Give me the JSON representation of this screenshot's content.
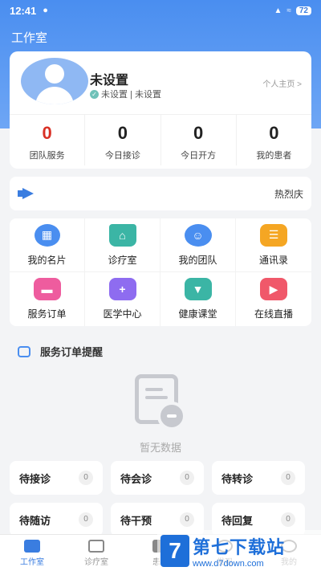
{
  "status": {
    "time": "12:41",
    "battery": "72"
  },
  "header": {
    "title": "工作室"
  },
  "profile": {
    "name": "未设置",
    "subtitle": "未设置 | 未设置",
    "home_link": "个人主页 >"
  },
  "stats": [
    {
      "value": "0",
      "label": "团队服务"
    },
    {
      "value": "0",
      "label": "今日接诊"
    },
    {
      "value": "0",
      "label": "今日开方"
    },
    {
      "value": "0",
      "label": "我的患者"
    }
  ],
  "notice": {
    "text": "热烈庆"
  },
  "menu": [
    {
      "label": "我的名片",
      "icon": "card-icon",
      "color": "#4a8ef0"
    },
    {
      "label": "诊疗室",
      "icon": "clinic-icon",
      "color": "#3bb5a5"
    },
    {
      "label": "我的团队",
      "icon": "team-icon",
      "color": "#4a8ef0"
    },
    {
      "label": "通讯录",
      "icon": "contacts-icon",
      "color": "#f5a623"
    },
    {
      "label": "服务订单",
      "icon": "order-icon",
      "color": "#ee5c9e"
    },
    {
      "label": "医学中心",
      "icon": "medical-center-icon",
      "color": "#8e6cf0"
    },
    {
      "label": "健康课堂",
      "icon": "classroom-icon",
      "color": "#3bb5a5"
    },
    {
      "label": "在线直播",
      "icon": "live-icon",
      "color": "#f0586a"
    }
  ],
  "section": {
    "title": "服务订单提醒"
  },
  "empty": {
    "text": "暂无数据"
  },
  "tasks": [
    {
      "label": "待接诊",
      "count": "0"
    },
    {
      "label": "待会诊",
      "count": "0"
    },
    {
      "label": "待转诊",
      "count": "0"
    },
    {
      "label": "待随访",
      "count": "0"
    },
    {
      "label": "待干预",
      "count": "0"
    },
    {
      "label": "待回复",
      "count": "0"
    }
  ],
  "tabbar": [
    {
      "label": "工作室",
      "icon": "studio-icon"
    },
    {
      "label": "诊疗室",
      "icon": "clinic-icon"
    },
    {
      "label": "患者",
      "icon": "patients-icon"
    },
    {
      "label": "发现",
      "icon": "discover-icon"
    },
    {
      "label": "我的",
      "icon": "profile-icon"
    }
  ],
  "watermark": {
    "logo": "7",
    "title": "第七下载站",
    "url": "www.d7down.com"
  }
}
